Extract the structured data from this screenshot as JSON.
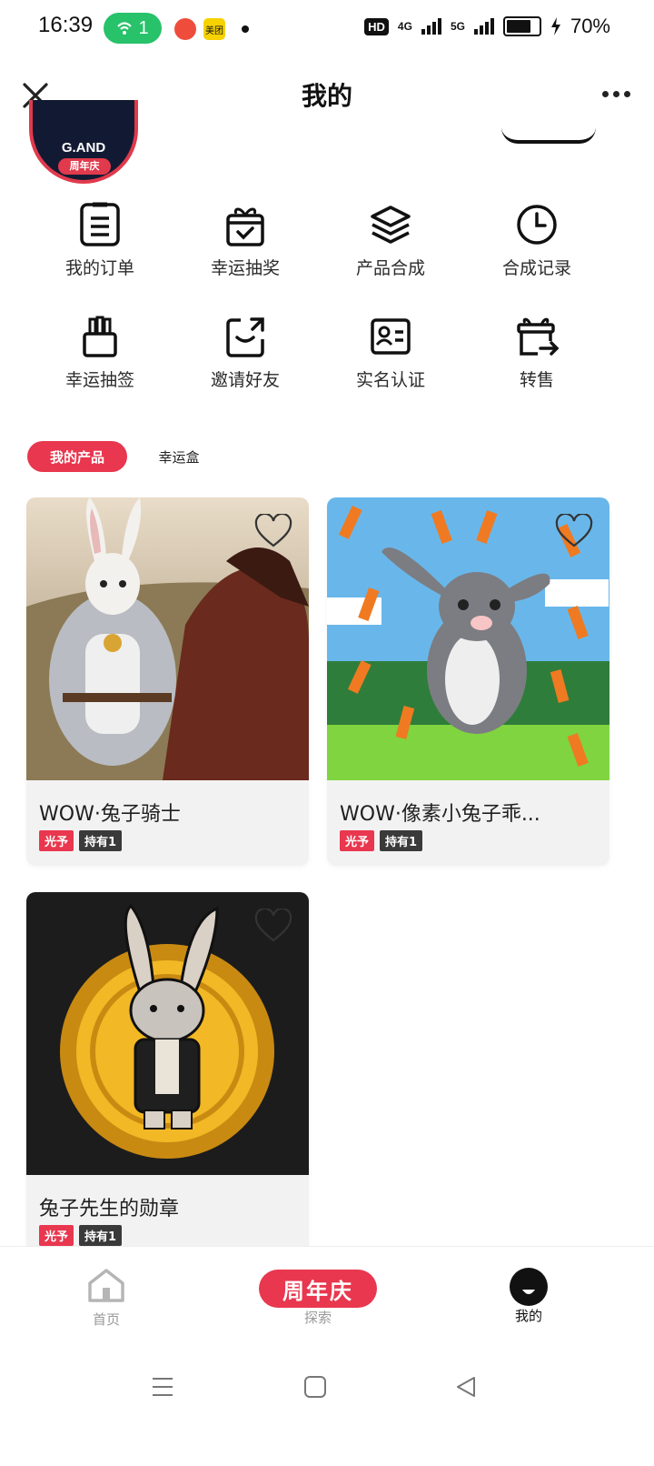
{
  "status_bar": {
    "time": "16:39",
    "hotspot_count": "1",
    "app_badge_2": "美团",
    "network_1": "HD",
    "network_2": "4G",
    "network_3": "5G",
    "battery_percent": "70%"
  },
  "header": {
    "title": "我的"
  },
  "profile": {
    "avatar_brand": "G.AND",
    "avatar_badge": "周年庆"
  },
  "menu": {
    "items": [
      {
        "label": "我的订单",
        "icon": "clipboard-list-icon"
      },
      {
        "label": "幸运抽奖",
        "icon": "gift-box-icon"
      },
      {
        "label": "产品合成",
        "icon": "layers-icon"
      },
      {
        "label": "合成记录",
        "icon": "clock-icon"
      },
      {
        "label": "幸运抽签",
        "icon": "lottery-sticks-icon"
      },
      {
        "label": "邀请好友",
        "icon": "share-bag-icon"
      },
      {
        "label": "实名认证",
        "icon": "id-card-icon"
      },
      {
        "label": "转售",
        "icon": "resale-box-icon"
      }
    ]
  },
  "tabs": {
    "active": "我的产品",
    "inactive": "幸运盒"
  },
  "products": [
    {
      "title": "WOW·兔子骑士",
      "tag_brand": "光予",
      "tag_hold": "持有1"
    },
    {
      "title": "WOW·像素小兔子乖...",
      "tag_brand": "光予",
      "tag_hold": "持有1"
    },
    {
      "title": "兔子先生的勋章",
      "tag_brand": "光予",
      "tag_hold": "持有1"
    }
  ],
  "bottom_nav": {
    "home": "首页",
    "promo": "周年庆",
    "explore": "探索",
    "mine": "我的"
  },
  "colors": {
    "accent": "#e8374e",
    "hotspot": "#27c26a"
  }
}
